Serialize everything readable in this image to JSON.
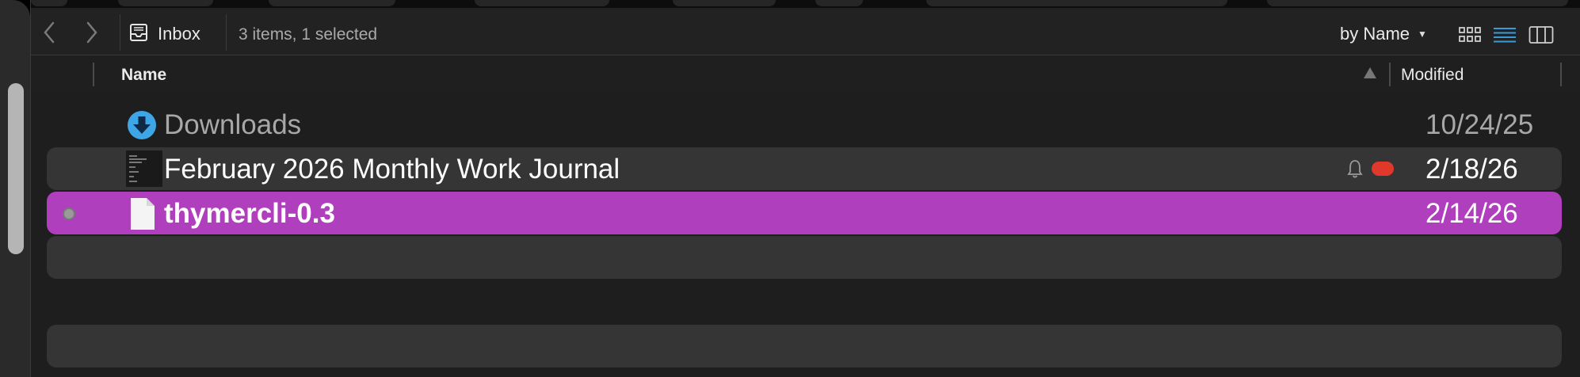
{
  "toolbar": {
    "location_label": "Inbox",
    "items_status": "3 items, 1 selected",
    "sort_label": "by Name",
    "back_icon": "chevron-left-icon",
    "forward_icon": "chevron-right-icon",
    "view_icons": [
      "icon-view-icon",
      "list-view-icon",
      "column-view-icon"
    ],
    "active_view": "list",
    "accent_color": "#3a9bd9"
  },
  "header": {
    "name_col": "Name",
    "modified_col": "Modified",
    "sort_direction": "ascending"
  },
  "rows": [
    {
      "name": "Downloads",
      "modified": "10/24/25",
      "kind": "folder",
      "icon": "downloads-icon",
      "selected": false
    },
    {
      "name": "February 2026 Monthly Work Journal",
      "modified": "2/18/26",
      "kind": "document",
      "icon": "document-thumbnail-icon",
      "selected": false,
      "has_reminder": true,
      "tag_color": "#e0382a"
    },
    {
      "name": "thymercli-0.3",
      "modified": "2/14/26",
      "kind": "file",
      "icon": "file-icon",
      "selected": true
    }
  ],
  "colors": {
    "selection": "#b03fbe",
    "background": "#1e1e1e",
    "alt_row": "#353535",
    "downloads_icon": "#3ea6e6"
  }
}
